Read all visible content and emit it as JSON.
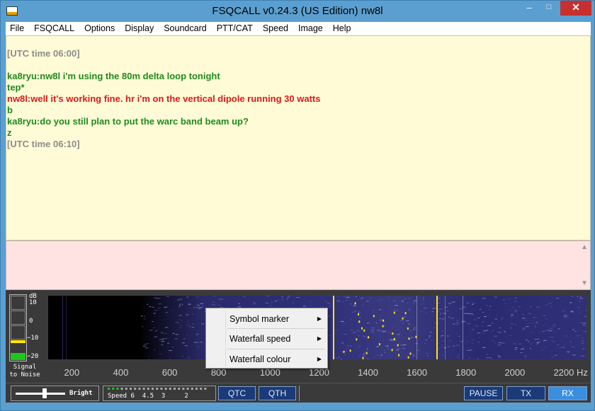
{
  "window": {
    "title": "FSQCALL v0.24.3 (US Edition)  nw8l"
  },
  "menu": [
    "File",
    "FSQCALL",
    "Options",
    "Display",
    "Soundcard",
    "PTT/CAT",
    "Speed",
    "Image",
    "Help"
  ],
  "chat": [
    {
      "text": "[UTC time 06:00]",
      "color": "gray"
    },
    {
      "text": "ka8ryu:nw8l i'm using the 80m delta loop tonight",
      "color": "green"
    },
    {
      "text": " tep*",
      "color": "green"
    },
    {
      "text": "nw8l:well it's working fine. hr i'm on the vertical dipole running 30 watts",
      "color": "red"
    },
    {
      "text": " b",
      "color": "green"
    },
    {
      "text": "ka8ryu:do you still plan to put the warc band beam up?",
      "color": "green"
    },
    {
      "text": " z",
      "color": "green"
    },
    {
      "text": "[UTC time 06:10]",
      "color": "gray"
    }
  ],
  "meter": {
    "dB": "dB",
    "ticks": [
      "10",
      "0",
      "−10",
      "−20"
    ],
    "label_line1": "Signal",
    "label_line2": "to Noise"
  },
  "waterfall": {
    "ticks": [
      "200",
      "400",
      "600",
      "800",
      "1000",
      "1200",
      "1400",
      "1600",
      "1800",
      "2000",
      "2200 Hz"
    ],
    "range_hz": [
      100,
      2300
    ]
  },
  "context_menu": [
    "Symbol marker",
    "Waterfall speed",
    "Waterfall colour"
  ],
  "status": {
    "bright_label": "Bright",
    "speed_label": "Speed 6  4.5  3     2",
    "qtc": "QTC",
    "qth": "QTH",
    "pause": "PAUSE",
    "tx": "TX",
    "rx": "RX"
  },
  "icons": {
    "close": "close-icon",
    "minimize": "minimize-icon",
    "maximize": "maximize-icon",
    "submenu": "chevron-right-icon"
  }
}
